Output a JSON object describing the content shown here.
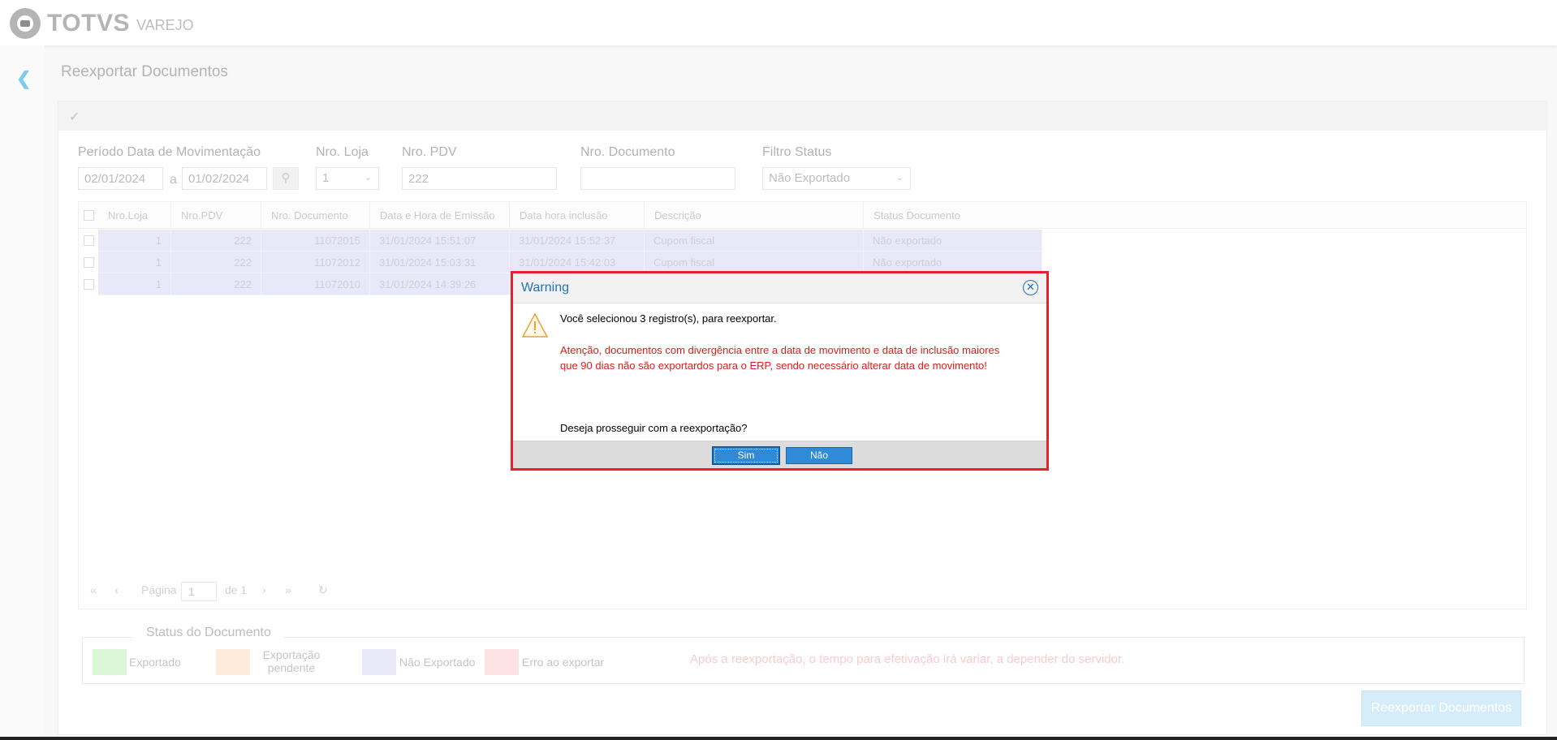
{
  "app": {
    "logo_text": "TOTVS",
    "logo_sub": "VAREJO"
  },
  "page": {
    "title": "Reexportar Documentos"
  },
  "filters": {
    "periodo_label": "Período Data de Movimentação",
    "date_from": "02/01/2024",
    "date_sep": "a",
    "date_to": "01/02/2024",
    "loja_label": "Nro. Loja",
    "loja_value": "1",
    "pdv_label": "Nro. PDV",
    "pdv_value": "222",
    "documento_label": "Nro. Documento",
    "documento_value": "",
    "status_label": "Filtro Status",
    "status_value": "Não Exportado"
  },
  "grid": {
    "columns": [
      "Nro.Loja",
      "Nro.PDV",
      "Nro. Documento",
      "Data e Hora de Emissão",
      "Data hora inclusão",
      "Descrição",
      "Status Documento"
    ],
    "rows": [
      [
        "1",
        "222",
        "11072015",
        "31/01/2024 15:51:07",
        "31/01/2024 15:52:37",
        "Cupom fiscal",
        "Não exportado"
      ],
      [
        "1",
        "222",
        "11072012",
        "31/01/2024 15:03:31",
        "31/01/2024 15:42:03",
        "Cupom fiscal",
        "Não exportado"
      ],
      [
        "1",
        "222",
        "11072010",
        "31/01/2024 14:39:26",
        "",
        "",
        ""
      ]
    ],
    "pager": {
      "page_label": "Página",
      "page_value": "1",
      "of_label": "de 1"
    }
  },
  "legend": {
    "title": "Status do Documento",
    "items": [
      {
        "label": "Exportado",
        "color": "#c8f5c0"
      },
      {
        "label": "Exportação pendente",
        "color": "#fde1c6"
      },
      {
        "label": "Não Exportado",
        "color": "#dcdcf4"
      },
      {
        "label": "Erro ao exportar",
        "color": "#fbd3d3"
      }
    ],
    "note": "Após a reexportação, o tempo para efetivação irá variar, a depender do servidor."
  },
  "actions": {
    "reexport_label": "Reexportar Documentos"
  },
  "dialog": {
    "title": "Warning",
    "line1": "Você selecionou 3 registro(s), para reexportar.",
    "warning_text": "Atenção, documentos com divergência entre a data de movimento e data de inclusão maiores que 90 dias não são exportardos para o ERP, sendo necessário alterar data de movimento!",
    "question": "Deseja prosseguir com a reexportação?",
    "yes_label": "Sim",
    "no_label": "Não"
  },
  "colors": {
    "accent": "#1f73b7",
    "highlight_border": "#e8202a",
    "row_selected": "#dcdcf4"
  }
}
